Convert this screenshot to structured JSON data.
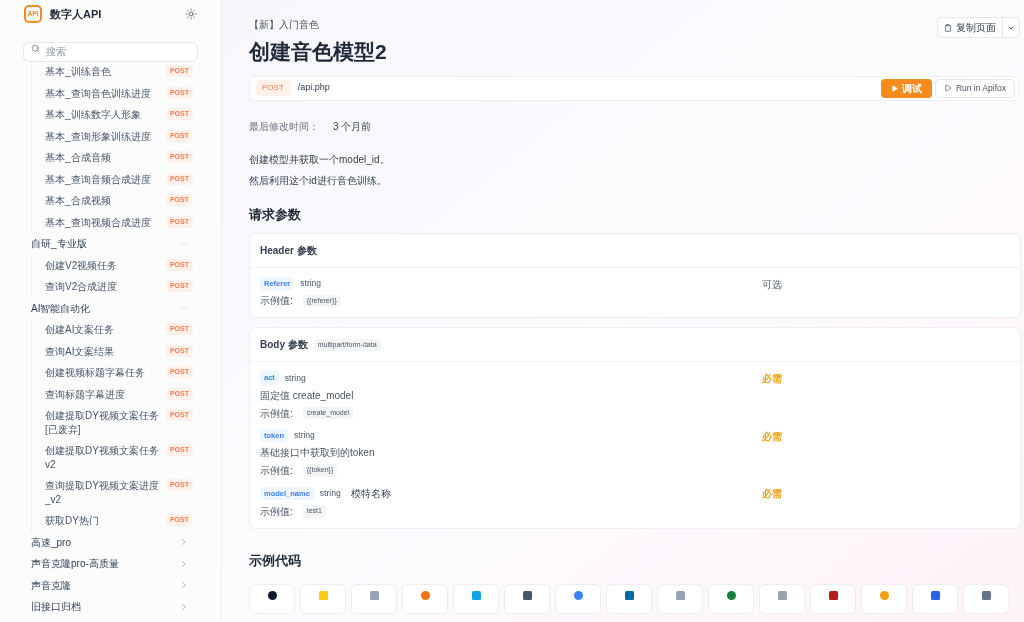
{
  "sidebar": {
    "logo": {
      "badge": "API",
      "title": "数字人API"
    },
    "search": {
      "placeholder": "搜索"
    },
    "nav": [
      {
        "kind": "continued",
        "children": [
          {
            "label": "基本_训练音色",
            "method": "POST"
          },
          {
            "label": "基本_查询音色训练进度",
            "method": "POST"
          },
          {
            "label": "基本_训练数字人形象",
            "method": "POST"
          },
          {
            "label": "基本_查询形象训练进度",
            "method": "POST"
          },
          {
            "label": "基本_合成音频",
            "method": "POST"
          },
          {
            "label": "基本_查询音频合成进度",
            "method": "POST"
          },
          {
            "label": "基本_合成视频",
            "method": "POST"
          },
          {
            "label": "基本_查询视频合成进度",
            "method": "POST"
          }
        ]
      },
      {
        "kind": "group",
        "label": "自研_专业版",
        "expanded": true,
        "children": [
          {
            "label": "创建V2视频任务",
            "method": "POST"
          },
          {
            "label": "查询V2合成进度",
            "method": "POST"
          }
        ]
      },
      {
        "kind": "group",
        "label": "AI智能自动化",
        "expanded": true,
        "children": [
          {
            "label": "创建AI文案任务",
            "method": "POST"
          },
          {
            "label": "查询AI文案结果",
            "method": "POST"
          },
          {
            "label": "创建视频标题字幕任务",
            "method": "POST"
          },
          {
            "label": "查询标题字幕进度",
            "method": "POST"
          },
          {
            "label": "创建提取DY视频文案任务[已废弃]",
            "method": "POST"
          },
          {
            "label": "创建提取DY视频文案任务v2",
            "method": "POST"
          },
          {
            "label": "查询提取DY视频文案进度_v2",
            "method": "POST"
          },
          {
            "label": "获取DY热门",
            "method": "POST"
          }
        ]
      },
      {
        "kind": "group",
        "label": "高速_pro",
        "expanded": false
      },
      {
        "kind": "group",
        "label": "声音克隆pro-高质量",
        "expanded": false
      },
      {
        "kind": "group",
        "label": "声音克隆",
        "expanded": false
      },
      {
        "kind": "group",
        "label": "旧接口归档",
        "expanded": false
      }
    ]
  },
  "page": {
    "breadcrumb": "【新】入门音色",
    "title": "创建音色模型2",
    "copy_button": "复制页面",
    "endpoint": {
      "method": "POST",
      "path": "/api.php",
      "try_button": "调试",
      "run_button": "Run in Apifox"
    },
    "modified": {
      "label": "最后修改时间：",
      "value": "3 个月前"
    },
    "description": [
      "创建模型并获取一个model_id。",
      "然后利用这个id进行音色训练。"
    ],
    "request_heading": "请求参数",
    "sections": [
      {
        "title": "Header 参数",
        "params": [
          {
            "name": "Referer",
            "type": "string",
            "required": false,
            "requirement": "可选",
            "example_label": "示例值:",
            "example": "{{referer}}"
          }
        ]
      },
      {
        "title": "Body 参数",
        "content_type": "multipart/form-data",
        "params": [
          {
            "name": "act",
            "type": "string",
            "required": true,
            "requirement": "必需",
            "note": "固定值 create_model",
            "example_label": "示例值:",
            "example": "create_model"
          },
          {
            "name": "token",
            "type": "string",
            "required": true,
            "requirement": "必需",
            "note": "基础接口中获取到的token",
            "example_label": "示例值:",
            "example": "{{token}}"
          },
          {
            "name": "model_name",
            "type": "string",
            "title": "模特名称",
            "required": true,
            "requirement": "必需",
            "example_label": "示例值:",
            "example": "test1"
          }
        ]
      }
    ],
    "code_heading": "示例代码"
  }
}
